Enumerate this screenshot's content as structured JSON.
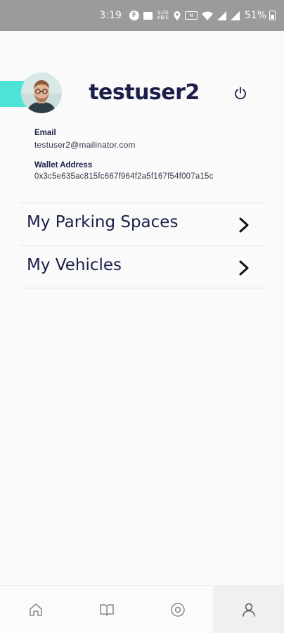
{
  "status_bar": {
    "time": "3:19",
    "battery": "51%",
    "data_speed": "0.00 KB/S",
    "icons": [
      "f-badge-icon",
      "gallery-icon",
      "data-speed-icon",
      "location-icon",
      "nfc-icon",
      "wifi-icon",
      "signal-icon",
      "signal-icon",
      "battery-icon"
    ]
  },
  "profile": {
    "username": "testuser2",
    "email_label": "Email",
    "email": "testuser2@mailinator.com",
    "wallet_label": "Wallet Address",
    "wallet": "0x3c5e635ac815fc667f964f2a5f167f54f007a15c",
    "accent_color": "#4fe3d8"
  },
  "menu": {
    "items": [
      {
        "label": "My Parking Spaces",
        "icon": "chevron-right-icon"
      },
      {
        "label": "My Vehicles",
        "icon": "chevron-right-icon"
      }
    ]
  },
  "bottom_nav": {
    "items": [
      {
        "icon": "home-icon",
        "active": false
      },
      {
        "icon": "book-icon",
        "active": false
      },
      {
        "icon": "target-icon",
        "active": false
      },
      {
        "icon": "user-icon",
        "active": true
      }
    ]
  },
  "colors": {
    "primary_text": "#1b1f4a",
    "status_bar": "#9b9b9b",
    "background": "#fafafa"
  }
}
